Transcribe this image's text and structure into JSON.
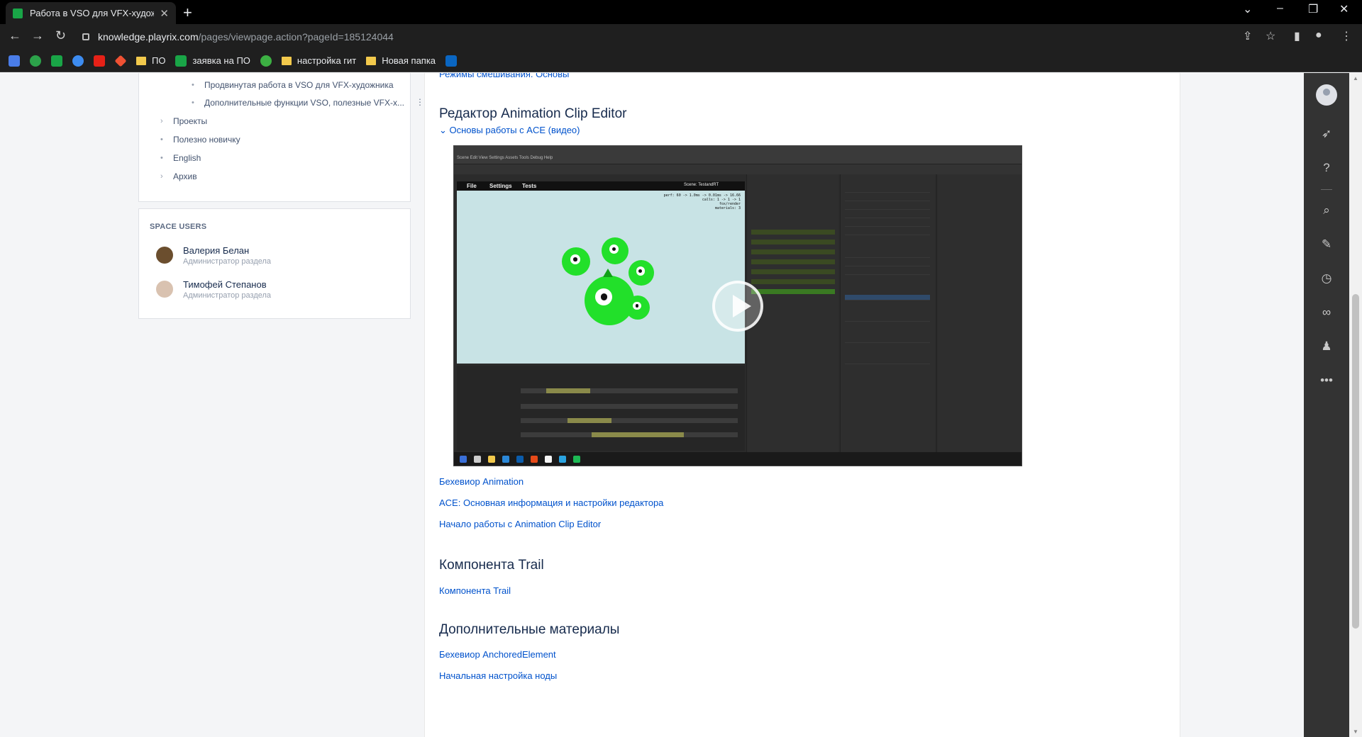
{
  "browser": {
    "tab_title": "Работа в VSO для VFX-художни",
    "url_host": "knowledge.playrix.com",
    "url_path": "/pages/viewpage.action?pageId=185124044",
    "bookmarks": [
      "ПО",
      "заявка на ПО",
      "настройка гит",
      "Новая папка"
    ]
  },
  "sidebar": {
    "tree": [
      {
        "label": "Продвинутая работа в VSO для VFX-художника",
        "marker": "•"
      },
      {
        "label": "Дополнительные функции VSO, полезные VFX-х...",
        "marker": "•"
      },
      {
        "label": "Проекты",
        "marker": "›"
      },
      {
        "label": "Полезно новичку",
        "marker": "•"
      },
      {
        "label": "English",
        "marker": "•"
      },
      {
        "label": "Архив",
        "marker": "›"
      }
    ],
    "space_users_title": "SPACE USERS",
    "users": [
      {
        "name": "Валерия Белан",
        "role": "Администратор раздела"
      },
      {
        "name": "Тимофей Степанов",
        "role": "Администратор раздела"
      }
    ]
  },
  "content": {
    "top_link": "Режимы смешивания. Основы",
    "section1": {
      "title": "Редактор Animation Clip Editor",
      "expand": "Основы работы с ACE (видео)",
      "links": [
        "Бехевиор Animation",
        "ACE: Основная информация и настройки редактора",
        "Начало работы с Animation Clip Editor"
      ]
    },
    "section2": {
      "title": "Компонента Trail",
      "links": [
        "Компонента Trail"
      ]
    },
    "section3": {
      "title": "Дополнительные материалы",
      "links": [
        "Бехевиор AnchoredElement",
        "Начальная настройка ноды"
      ]
    }
  },
  "video": {
    "app_menu": [
      "File",
      "Settings",
      "Tests"
    ],
    "scene_label": "Scene: TestandRT",
    "stats": [
      "perf: 60 -> 1.0ms -> 0.01ms -> 16.66",
      "calls: 1 -> 1 -> 1",
      "fox/render",
      "materials: 3"
    ],
    "menubar": "Scene  Edit  View  Settings  Assets  Tools  Debug  Help"
  },
  "colors": {
    "link": "#0052cc",
    "heading": "#172b4d",
    "rail_bg": "#333333",
    "chrome_bg": "#1f1f1f"
  }
}
